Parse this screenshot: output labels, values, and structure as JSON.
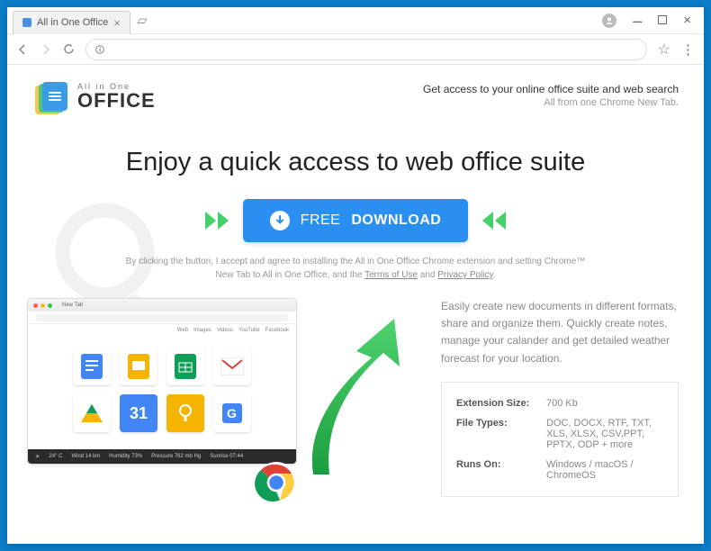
{
  "browser": {
    "tab_title": "All in One Office",
    "url": ""
  },
  "logo": {
    "subtitle": "All in One",
    "title": "OFFICE"
  },
  "tagline": {
    "line1": "Get access to your online office suite and web search",
    "line2": "All from one Chrome New Tab."
  },
  "headline": "Enjoy a quick access to web office suite",
  "cta": {
    "word1": "FREE",
    "word2": "DOWNLOAD"
  },
  "disclaimer": {
    "prefix": "By clicking the button, I accept and agree to installing the All in One Office Chrome extension and setting Chrome™ New Tab to All in One Office, and the ",
    "terms": "Terms of Use",
    "mid": " and ",
    "privacy": "Privacy Policy",
    "suffix": "."
  },
  "description": "Easily create new documents in different formats, share and organize them. Quickly create notes, manage your calander and get detailed weather forecast for your location.",
  "specs": {
    "rows": [
      {
        "label": "Extension Size:",
        "value": "700 Kb"
      },
      {
        "label": "File Types:",
        "value": "DOC, DOCX, RTF, TXT, XLS, XLSX, CSV,PPT, PPTX, ODP + more"
      },
      {
        "label": "Runs On:",
        "value": "Windows / macOS / ChromeOS"
      }
    ]
  },
  "screenshot": {
    "tab": "New Tab",
    "nav": [
      "Web",
      "Images",
      "Videos",
      "YouTube",
      "Facebook"
    ],
    "footer": {
      "temp": "24° C",
      "wind": "Wind 14 km",
      "humidity": "Humidity 73%",
      "pressure": "Pressure 762 mb Hg",
      "sunrise": "Sunrise 07:44"
    },
    "apps_colors": [
      "#4285f4",
      "#f4b400",
      "#0f9d58",
      "#fff",
      "#f4b400",
      "#4285f4",
      "#f4b400",
      "#4285f4"
    ]
  }
}
